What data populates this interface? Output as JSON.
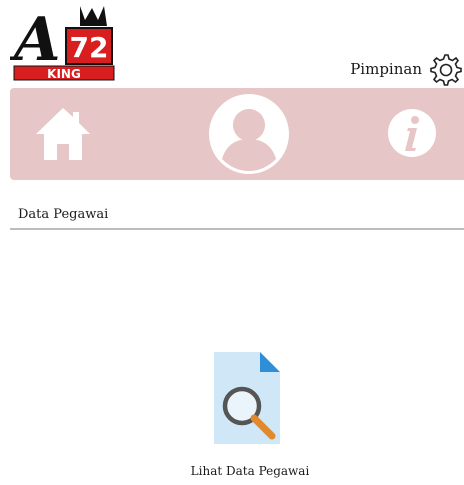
{
  "header": {
    "logo": {
      "letter": "A",
      "number": "72",
      "word": "KING",
      "alt": "A72 King logo"
    },
    "user_role": "Pimpinan",
    "settings_icon": "gear-icon"
  },
  "navbar": {
    "items": [
      {
        "id": "home",
        "icon": "home-icon"
      },
      {
        "id": "profile",
        "icon": "user-avatar-icon"
      },
      {
        "id": "info",
        "icon": "info-icon"
      }
    ],
    "background": "#e6c6c6"
  },
  "section": {
    "title": "Data Pegawai"
  },
  "action": {
    "label": "Lihat Data Pegawai",
    "icon": "document-search-icon"
  },
  "colors": {
    "accent": "#e6c6c6",
    "logo_red": "#d81e1e",
    "doc_blue": "#bfe0f5",
    "magnifier_orange": "#e08a2c"
  }
}
